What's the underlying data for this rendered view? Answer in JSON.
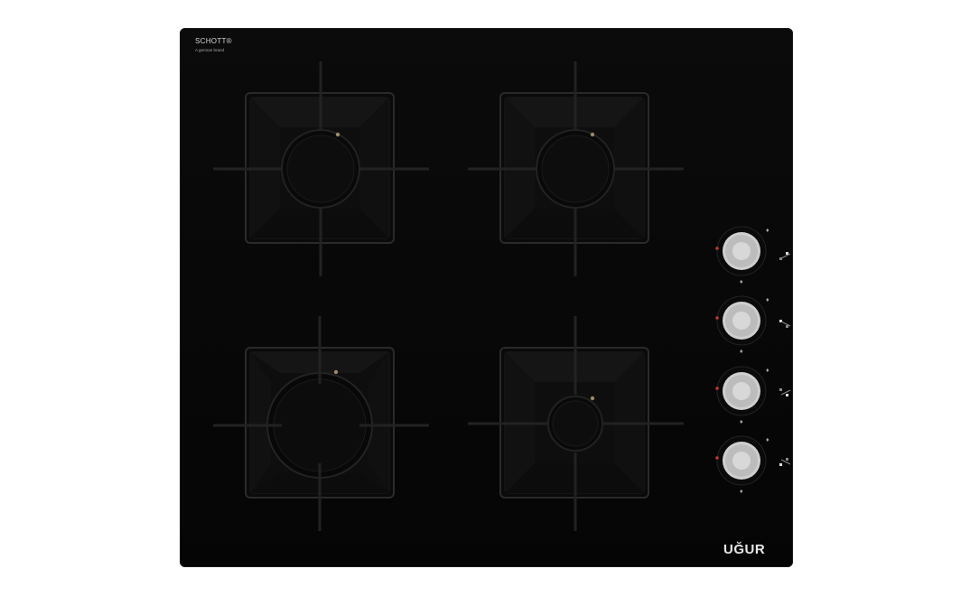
{
  "hob": {
    "logo_text": "SCHOTT®",
    "logo_subtext": "A german brand",
    "brand_text": "UĞUR"
  },
  "burners": [
    {
      "id": "rear-left",
      "size": "medium"
    },
    {
      "id": "rear-right",
      "size": "medium"
    },
    {
      "id": "front-left",
      "size": "large"
    },
    {
      "id": "front-right",
      "size": "small"
    }
  ],
  "knobs": [
    {
      "id": "knob-1",
      "icon": "rear-right-burner-indicator-icon"
    },
    {
      "id": "knob-2",
      "icon": "rear-left-burner-indicator-icon"
    },
    {
      "id": "knob-3",
      "icon": "front-right-burner-indicator-icon"
    },
    {
      "id": "knob-4",
      "icon": "front-left-burner-indicator-icon"
    }
  ],
  "colors": {
    "glass": "#080808",
    "knob": "#c8c8c8",
    "ignition_dot": "#c0392b"
  }
}
